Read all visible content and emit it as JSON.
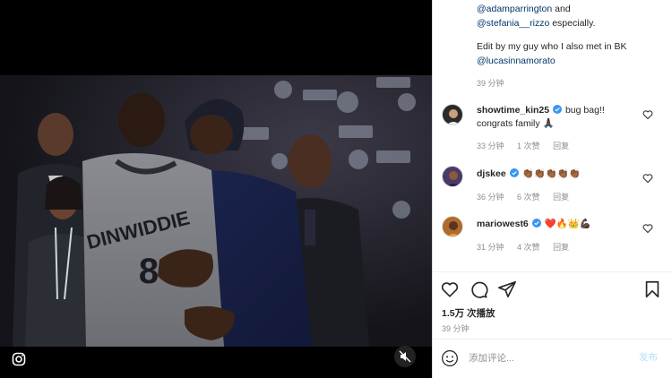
{
  "video": {
    "jersey_text": "DINWIDDIE",
    "jersey_number": "8",
    "icons": {
      "logo": "instagram-logo-icon",
      "mute": "muted-speaker-icon"
    }
  },
  "caption": {
    "line1_mention": "@adamparrington",
    "line1_suffix": " and",
    "line2_mention": "@stefania__rizzo",
    "line2_suffix": " especially.",
    "line3": "Edit by my guy who I also met in BK",
    "line4_mention": "@lucasinnamorato",
    "time": "39 分钟"
  },
  "comments": [
    {
      "username": "showtime_kin25",
      "verified": true,
      "text": "bug bag!! congrats family 🙏🏿",
      "time": "33 分钟",
      "likes": "1 次赞",
      "reply": "回复",
      "avatar_color": "#2a2a2a"
    },
    {
      "username": "djskee",
      "verified": true,
      "text": "👏🏾👏🏾👏🏾👏🏾👏🏾",
      "time": "36 分钟",
      "likes": "6 次赞",
      "reply": "回复",
      "avatar_color": "#4a3a6a"
    },
    {
      "username": "mariowest6",
      "verified": true,
      "text": "❤️🔥👑💪🏿",
      "time": "31 分钟",
      "likes": "4 次赞",
      "reply": "回复",
      "avatar_color": "#b06a2c"
    }
  ],
  "actions": {
    "icons": [
      "heart-icon",
      "comment-icon",
      "share-icon",
      "bookmark-icon"
    ]
  },
  "stats": {
    "views": "1.5万 次播放",
    "time": "39 分钟"
  },
  "input": {
    "placeholder": "添加评论...",
    "post_label": "发布"
  },
  "colors": {
    "mention": "#00376b",
    "verified": "#3897f0",
    "post_button": "#b2dffc"
  }
}
